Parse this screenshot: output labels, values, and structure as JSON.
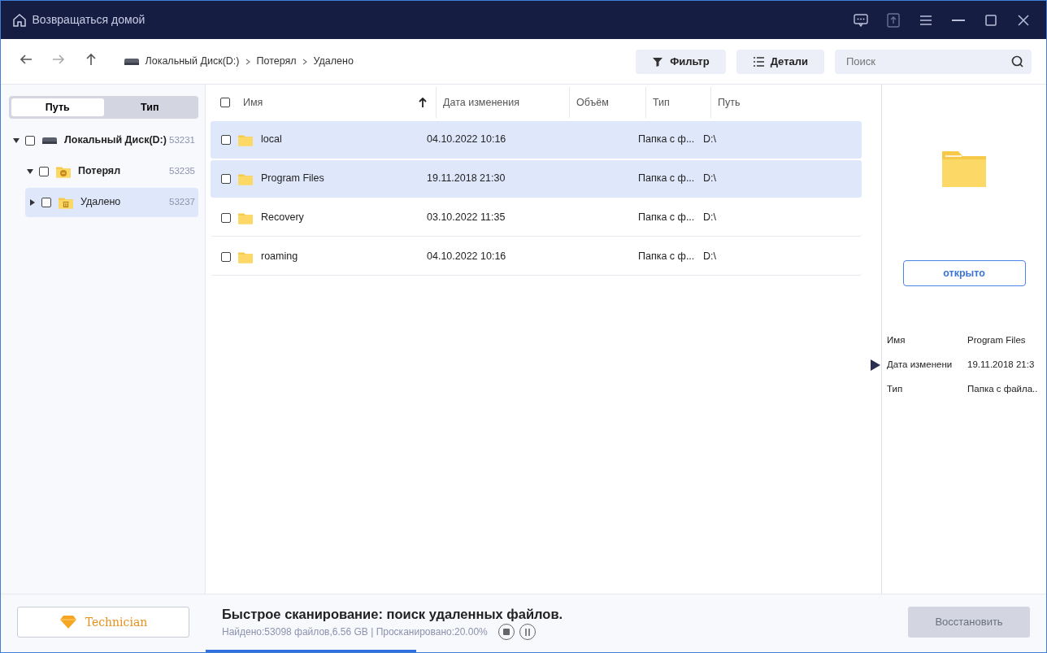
{
  "window": {
    "title": "Возвращаться домой"
  },
  "toolbar": {
    "breadcrumb": [
      {
        "label": "Локальный Диск(D:)",
        "kind": "drive"
      },
      {
        "label": "Потерял",
        "kind": "folder"
      },
      {
        "label": "Удалено",
        "kind": "folder"
      }
    ],
    "buttons": [
      "Фильтр",
      "Детали"
    ],
    "search": {
      "placeholder": "Поиск"
    }
  },
  "sidebar": {
    "tabs": [
      {
        "label": "Путь",
        "selected": true
      },
      {
        "label": "Тип",
        "selected": false
      }
    ],
    "tree": [
      {
        "label": "Локальный Диск(D:)",
        "count": "53231",
        "kind": "drive",
        "expanded": true,
        "checked": false,
        "selected": false,
        "children": [
          {
            "label": "Потерял",
            "count": "53235",
            "kind": "lost",
            "expanded": true,
            "checked": false,
            "selected": false,
            "children": [
              {
                "label": "Удалено",
                "count": "53237",
                "kind": "deleted",
                "expanded": false,
                "checked": false,
                "selected": true
              }
            ]
          }
        ]
      }
    ],
    "upgrade_button": "Technician"
  },
  "table": {
    "select_all": {
      "checked": false
    },
    "columns": [
      "Имя",
      "Дата изменения",
      "Объём",
      "Тип",
      "Путь"
    ],
    "rows": [
      {
        "name": "local",
        "date": "04.10.2022 10:16",
        "type": "Папка с ф...",
        "path": "D:\\",
        "selected": true,
        "checked": false
      },
      {
        "name": "Program Files",
        "date": "19.11.2018 21:30",
        "type": "Папка с ф...",
        "path": "D:\\",
        "selected": true,
        "checked": false
      },
      {
        "name": "Recovery",
        "date": "03.10.2022 11:35",
        "type": "Папка с ф...",
        "path": "D:\\",
        "selected": false,
        "checked": false
      },
      {
        "name": "roaming",
        "date": "04.10.2022 10:16",
        "type": "Папка с ф...",
        "path": "D:\\",
        "selected": false,
        "checked": false
      }
    ]
  },
  "details": {
    "open_button": "открыто",
    "properties": [
      {
        "label": "Имя",
        "value": "Program Files"
      },
      {
        "label": "Дата изменени",
        "value": "19.11.2018 21:3"
      },
      {
        "label": "Тип",
        "value": "Папка с файла.."
      }
    ]
  },
  "status_bar": {
    "title": "Быстрое сканирование: поиск удаленных файлов.",
    "stats": "Найдено:53098 файлов,6.56 GB | Просканировано:20.00%",
    "level": 0.25,
    "recover_button": {
      "label": "Восстановить",
      "disabled": true
    }
  }
}
